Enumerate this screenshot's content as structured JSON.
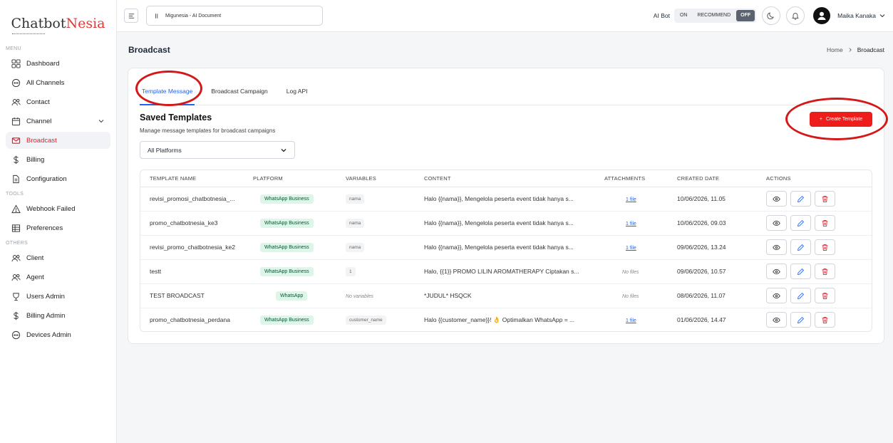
{
  "brand": {
    "logo_main": "Chatbot",
    "logo_accent": "Nesia"
  },
  "sidebar": {
    "section_menu": "MENU",
    "section_tools": "TOOLS",
    "section_others": "OTHERS",
    "menu_items": [
      {
        "label": "Dashboard",
        "icon": "grid-icon"
      },
      {
        "label": "All Channels",
        "icon": "chat-icon"
      },
      {
        "label": "Contact",
        "icon": "users-icon"
      },
      {
        "label": "Channel",
        "icon": "calendar-icon"
      },
      {
        "label": "Broadcast",
        "icon": "mail-icon",
        "active": true
      },
      {
        "label": "Billing",
        "icon": "dollar-icon"
      },
      {
        "label": "Configuration",
        "icon": "file-icon"
      }
    ],
    "tools_items": [
      {
        "label": "Webhook Failed",
        "icon": "warning-icon"
      },
      {
        "label": "Preferences",
        "icon": "table-icon"
      }
    ],
    "others_items": [
      {
        "label": "Client",
        "icon": "users-icon"
      },
      {
        "label": "Agent",
        "icon": "users-icon"
      },
      {
        "label": "Users Admin",
        "icon": "shield-icon"
      },
      {
        "label": "Billing Admin",
        "icon": "dollar-icon"
      },
      {
        "label": "Devices Admin",
        "icon": "chat-icon"
      }
    ]
  },
  "topbar": {
    "document_select": "Migunesia - AI Document",
    "aibot_label": "AI Bot",
    "toggle_on": "ON",
    "toggle_recommend": "RECOMMEND",
    "toggle_off": "OFF",
    "user_name": "Maika Kanaka"
  },
  "page": {
    "title": "Broadcast",
    "breadcrumb_home": "Home",
    "breadcrumb_current": "Broadcast"
  },
  "tabs": [
    "Template Message",
    "Broadcast Campaign",
    "Log API"
  ],
  "templates": {
    "title": "Saved Templates",
    "subtitle": "Manage message templates for broadcast campaigns",
    "create_button": "Create Template",
    "platform_filter": "All Platforms"
  },
  "table": {
    "columns": [
      "TEMPLATE NAME",
      "PLATFORM",
      "VARIABLES",
      "CONTENT",
      "ATTACHMENTS",
      "CREATED DATE",
      "ACTIONS"
    ],
    "rows": [
      {
        "name": "revisi_promosi_chatbotnesia_...",
        "platform": "WhatsApp Business",
        "variables": "nama",
        "content": "Halo {{nama}}, Mengelola peserta event tidak hanya s...",
        "attachments": "1 file",
        "created": "10/06/2026, 11.05"
      },
      {
        "name": "promo_chatbotnesia_ke3",
        "platform": "WhatsApp Business",
        "variables": "nama",
        "content": "Halo {{nama}}, Mengelola peserta event tidak hanya s...",
        "attachments": "1 file",
        "created": "10/06/2026, 09.03"
      },
      {
        "name": "revisi_promo_chatbotnesia_ke2",
        "platform": "WhatsApp Business",
        "variables": "nama",
        "content": "Halo {{nama}}, Mengelola peserta event tidak hanya s...",
        "attachments": "1 file",
        "created": "09/06/2026, 13.24"
      },
      {
        "name": "testt",
        "platform": "WhatsApp Business",
        "variables": "1",
        "content": "Halo, {{1}} PROMO LILIN AROMATHERAPY Ciptakan s...",
        "attachments": "No files",
        "created": "09/06/2026, 10.57"
      },
      {
        "name": "TEST BROADCAST",
        "platform": "WhatsApp",
        "variables": "No variables",
        "content": "*JUDUL* HSQCK",
        "attachments": "No files",
        "created": "08/06/2026, 11.07"
      },
      {
        "name": "promo_chatbotnesia_perdana",
        "platform": "WhatsApp Business",
        "variables": "customer_name",
        "content": "Halo {{customer_name}}! 👌 Optimalkan WhatsApp = ...",
        "attachments": "1 file",
        "created": "01/06/2026, 14.47"
      }
    ]
  },
  "colors": {
    "accent_red": "#ef1c1c",
    "tab_blue": "#2563eb",
    "badge_green": "#dcf7e9"
  }
}
